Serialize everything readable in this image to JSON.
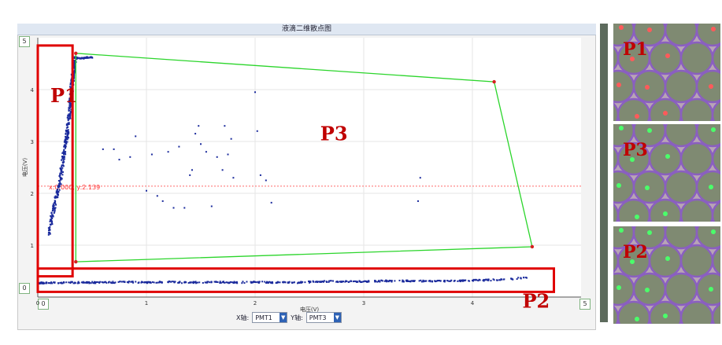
{
  "window": {
    "title": "液滴二维散点图"
  },
  "controls": {
    "x_axis_label": "X轴:",
    "x_axis_value": "PMT1",
    "y_axis_label": "Y轴:",
    "y_axis_value": "PMT3",
    "corner_labels": {
      "top_left": "5",
      "bottom_left_y": "0",
      "bottom_left_x": "0",
      "bottom_right": "5"
    }
  },
  "threshold": {
    "label": "x:0.000, y:2.139"
  },
  "chart_data": {
    "type": "scatter",
    "title": "液滴二维散点图",
    "xlabel": "电压(V)",
    "ylabel": "电压(V)",
    "xlim": [
      0,
      5
    ],
    "ylim": [
      0,
      5
    ],
    "x_ticks": [
      "0",
      "1",
      "2",
      "3",
      "4"
    ],
    "y_ticks": [
      "1",
      "2",
      "3",
      "4"
    ],
    "threshold_y": 2.139,
    "colors": {
      "points": "#1a2a9c",
      "gate_box": "#e00000",
      "polygon": "#2bd52b",
      "threshold": "#ff6b6b"
    },
    "series": [
      {
        "name": "P1",
        "points": [
          [
            0.1,
            1.2
          ],
          [
            0.12,
            1.4
          ],
          [
            0.13,
            1.55
          ],
          [
            0.15,
            1.7
          ],
          [
            0.16,
            1.85
          ],
          [
            0.18,
            2.0
          ],
          [
            0.2,
            2.15
          ],
          [
            0.21,
            2.3
          ],
          [
            0.22,
            2.45
          ],
          [
            0.23,
            2.6
          ],
          [
            0.24,
            2.75
          ],
          [
            0.25,
            2.9
          ],
          [
            0.26,
            3.0
          ],
          [
            0.27,
            3.1
          ],
          [
            0.27,
            3.2
          ],
          [
            0.28,
            3.35
          ],
          [
            0.29,
            3.5
          ],
          [
            0.3,
            3.65
          ],
          [
            0.3,
            3.8
          ],
          [
            0.31,
            3.9
          ],
          [
            0.31,
            4.05
          ],
          [
            0.32,
            4.15
          ],
          [
            0.32,
            4.25
          ],
          [
            0.33,
            4.35
          ],
          [
            0.33,
            4.45
          ],
          [
            0.34,
            4.55
          ],
          [
            0.35,
            4.62
          ],
          [
            0.4,
            4.6
          ],
          [
            0.45,
            4.62
          ],
          [
            0.5,
            4.62
          ]
        ]
      },
      {
        "name": "P2",
        "points": [
          [
            0.0,
            0.27
          ],
          [
            0.1,
            0.27
          ],
          [
            0.3,
            0.28
          ],
          [
            0.45,
            0.28
          ],
          [
            0.6,
            0.28
          ],
          [
            0.8,
            0.29
          ],
          [
            1.0,
            0.28
          ],
          [
            1.2,
            0.29
          ],
          [
            1.4,
            0.28
          ],
          [
            1.6,
            0.29
          ],
          [
            1.8,
            0.28
          ],
          [
            2.0,
            0.29
          ],
          [
            2.2,
            0.28
          ],
          [
            2.4,
            0.28
          ],
          [
            2.6,
            0.3
          ],
          [
            2.8,
            0.3
          ],
          [
            3.0,
            0.3
          ],
          [
            3.2,
            0.31
          ],
          [
            3.4,
            0.31
          ],
          [
            3.6,
            0.31
          ],
          [
            3.8,
            0.31
          ],
          [
            4.0,
            0.32
          ],
          [
            4.2,
            0.33
          ],
          [
            4.5,
            0.37
          ]
        ]
      },
      {
        "name": "P3",
        "points": [
          [
            0.6,
            2.85
          ],
          [
            0.7,
            2.85
          ],
          [
            0.75,
            2.65
          ],
          [
            0.85,
            2.7
          ],
          [
            0.9,
            3.1
          ],
          [
            1.0,
            2.05
          ],
          [
            1.05,
            2.75
          ],
          [
            1.1,
            1.95
          ],
          [
            1.15,
            1.85
          ],
          [
            1.2,
            2.8
          ],
          [
            1.25,
            1.72
          ],
          [
            1.3,
            2.9
          ],
          [
            1.35,
            1.72
          ],
          [
            1.4,
            2.35
          ],
          [
            1.42,
            2.45
          ],
          [
            1.45,
            3.15
          ],
          [
            1.48,
            3.3
          ],
          [
            1.5,
            2.95
          ],
          [
            1.55,
            2.8
          ],
          [
            1.6,
            1.75
          ],
          [
            1.65,
            2.7
          ],
          [
            1.7,
            2.45
          ],
          [
            1.72,
            3.3
          ],
          [
            1.75,
            2.75
          ],
          [
            1.78,
            3.05
          ],
          [
            1.8,
            2.3
          ],
          [
            2.0,
            3.95
          ],
          [
            2.02,
            3.2
          ],
          [
            2.05,
            2.35
          ],
          [
            2.1,
            2.25
          ],
          [
            2.15,
            1.82
          ],
          [
            3.5,
            1.85
          ],
          [
            3.52,
            2.3
          ]
        ]
      }
    ],
    "gates": [
      {
        "name": "P1",
        "kind": "rect",
        "x": [
          0.0,
          0.32
        ],
        "y": [
          0.4,
          4.85
        ]
      },
      {
        "name": "P2",
        "kind": "rect",
        "x": [
          0.0,
          4.75
        ],
        "y": [
          0.1,
          0.55
        ]
      },
      {
        "name": "P3",
        "kind": "polygon",
        "vertices": [
          [
            0.35,
            4.7
          ],
          [
            4.2,
            4.15
          ],
          [
            4.55,
            0.97
          ],
          [
            0.35,
            0.68
          ]
        ]
      }
    ]
  },
  "thumbnails": [
    {
      "label": "P1",
      "dot_color": "#ff5a5a"
    },
    {
      "label": "P3",
      "dot_color": "#4aff6a"
    },
    {
      "label": "P2",
      "dot_color": "#4aff6a"
    }
  ]
}
